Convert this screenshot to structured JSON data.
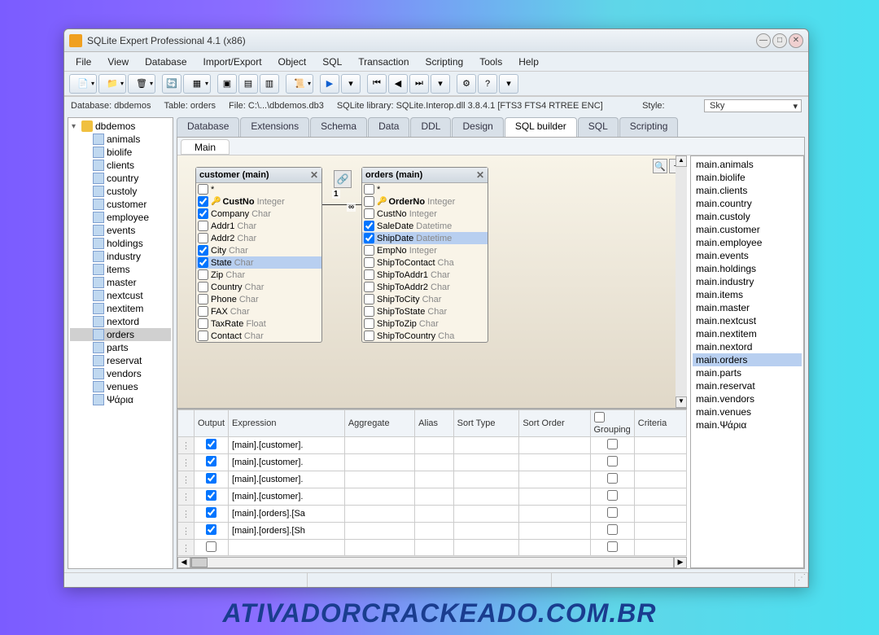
{
  "title": "SQLite Expert Professional 4.1 (x86)",
  "menu": [
    "File",
    "View",
    "Database",
    "Import/Export",
    "Object",
    "SQL",
    "Transaction",
    "Scripting",
    "Tools",
    "Help"
  ],
  "status": {
    "db": "Database: dbdemos",
    "table": "Table: orders",
    "file": "File: C:\\...\\dbdemos.db3",
    "lib": "SQLite library: SQLite.Interop.dll 3.8.4.1 [FTS3 FTS4 RTREE ENC]",
    "style_label": "Style:",
    "style_value": "Sky"
  },
  "tree": {
    "root": "dbdemos",
    "items": [
      "animals",
      "biolife",
      "clients",
      "country",
      "custoly",
      "customer",
      "employee",
      "events",
      "holdings",
      "industry",
      "items",
      "master",
      "nextcust",
      "nextitem",
      "nextord",
      "orders",
      "parts",
      "reservat",
      "vendors",
      "venues",
      "Ψάρια"
    ],
    "selected": "orders"
  },
  "tabs": [
    "Database",
    "Extensions",
    "Schema",
    "Data",
    "DDL",
    "Design",
    "SQL builder",
    "SQL",
    "Scripting"
  ],
  "active_tab": "SQL builder",
  "subtab": "Main",
  "tables": {
    "customer": {
      "title": "customer (main)",
      "fields": [
        {
          "chk": false,
          "name": "*",
          "type": ""
        },
        {
          "chk": true,
          "pk": true,
          "name": "CustNo",
          "type": "Integer"
        },
        {
          "chk": true,
          "name": "Company",
          "type": "Char"
        },
        {
          "chk": false,
          "name": "Addr1",
          "type": "Char"
        },
        {
          "chk": false,
          "name": "Addr2",
          "type": "Char"
        },
        {
          "chk": true,
          "name": "City",
          "type": "Char"
        },
        {
          "chk": true,
          "name": "State",
          "type": "Char",
          "sel": true
        },
        {
          "chk": false,
          "name": "Zip",
          "type": "Char"
        },
        {
          "chk": false,
          "name": "Country",
          "type": "Char"
        },
        {
          "chk": false,
          "name": "Phone",
          "type": "Char"
        },
        {
          "chk": false,
          "name": "FAX",
          "type": "Char"
        },
        {
          "chk": false,
          "name": "TaxRate",
          "type": "Float"
        },
        {
          "chk": false,
          "name": "Contact",
          "type": "Char"
        }
      ]
    },
    "orders": {
      "title": "orders (main)",
      "fields": [
        {
          "chk": false,
          "name": "*",
          "type": ""
        },
        {
          "chk": false,
          "pk": true,
          "name": "OrderNo",
          "type": "Integer"
        },
        {
          "chk": false,
          "name": "CustNo",
          "type": "Integer"
        },
        {
          "chk": true,
          "name": "SaleDate",
          "type": "Datetime"
        },
        {
          "chk": true,
          "name": "ShipDate",
          "type": "Datetime",
          "sel": true
        },
        {
          "chk": false,
          "name": "EmpNo",
          "type": "Integer"
        },
        {
          "chk": false,
          "name": "ShipToContact",
          "type": "Cha"
        },
        {
          "chk": false,
          "name": "ShipToAddr1",
          "type": "Char"
        },
        {
          "chk": false,
          "name": "ShipToAddr2",
          "type": "Char"
        },
        {
          "chk": false,
          "name": "ShipToCity",
          "type": "Char"
        },
        {
          "chk": false,
          "name": "ShipToState",
          "type": "Char"
        },
        {
          "chk": false,
          "name": "ShipToZip",
          "type": "Char"
        },
        {
          "chk": false,
          "name": "ShipToCountry",
          "type": "Cha"
        }
      ]
    }
  },
  "relation": {
    "label1": "1",
    "label2": "∞"
  },
  "grid": {
    "cols": [
      "Output",
      "Expression",
      "Aggregate",
      "Alias",
      "Sort Type",
      "Sort Order",
      "Grouping",
      "Criteria"
    ],
    "rows": [
      {
        "output": true,
        "expr": "[main].[customer]."
      },
      {
        "output": true,
        "expr": "[main].[customer]."
      },
      {
        "output": true,
        "expr": "[main].[customer]."
      },
      {
        "output": true,
        "expr": "[main].[customer]."
      },
      {
        "output": true,
        "expr": "[main].[orders].[Sa"
      },
      {
        "output": true,
        "expr": "[main].[orders].[Sh"
      },
      {
        "output": false,
        "expr": ""
      }
    ]
  },
  "right_list": [
    "main.animals",
    "main.biolife",
    "main.clients",
    "main.country",
    "main.custoly",
    "main.customer",
    "main.employee",
    "main.events",
    "main.holdings",
    "main.industry",
    "main.items",
    "main.master",
    "main.nextcust",
    "main.nextitem",
    "main.nextord",
    "main.orders",
    "main.parts",
    "main.reservat",
    "main.vendors",
    "main.venues",
    "main.Ψάρια"
  ],
  "right_selected": "main.orders",
  "watermark": "ATIVADORCRACKEADO.COM.BR"
}
